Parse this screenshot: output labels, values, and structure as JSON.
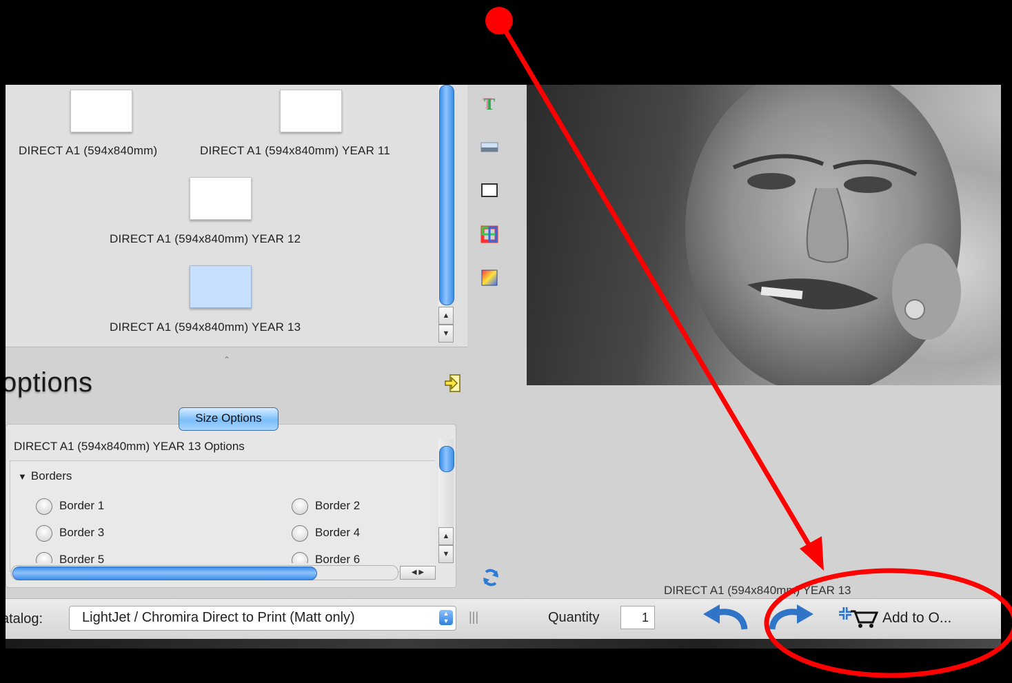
{
  "sizes": {
    "items": [
      {
        "label": "DIRECT A1 (594x840mm)"
      },
      {
        "label": "DIRECT A1 (594x840mm) YEAR 11"
      },
      {
        "label": "DIRECT A1 (594x840mm) YEAR 12"
      },
      {
        "label": "DIRECT A1 (594x840mm) YEAR 13"
      }
    ],
    "selected": "DIRECT A1 (594x840mm) YEAR 13"
  },
  "options": {
    "title": "options",
    "tab_label": "Size Options",
    "group_title": "DIRECT A1 (594x840mm) YEAR 13 Options",
    "section_title": "Borders",
    "section_arrow": "▼",
    "borders": [
      "Border 1",
      "Border 2",
      "Border 3",
      "Border 4",
      "Border 5",
      "Border 6"
    ]
  },
  "preview": {
    "caption": "DIRECT A1 (594x840mm) YEAR 13"
  },
  "bottom_bar": {
    "catalog_label": "atalog:",
    "catalog_value": "LightJet / Chromira Direct to Print (Matt only)",
    "quantity_label": "Quantity",
    "quantity_value": "1",
    "add_to_order_label": "Add to O..."
  },
  "tools": [
    "text-tool-icon",
    "image-tool-icon",
    "frame-tool-icon",
    "color-frame-tool-icon",
    "gradient-tool-icon",
    "refresh-icon"
  ],
  "colors": {
    "annotation": "#ff0000",
    "accent_blue": "#3c8de6",
    "panel_gray": "#d2d2d2"
  }
}
